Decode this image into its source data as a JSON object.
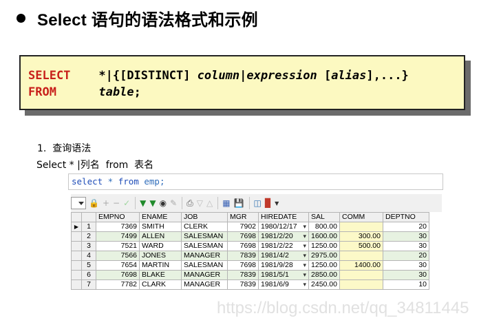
{
  "title": "Select 语句的语法格式和示例",
  "syntax": {
    "line1": {
      "kw": "SELECT",
      "rest_plain": "*|{[DISTINCT] ",
      "rest_italic_1": "column",
      "rest_plain_2": "|",
      "rest_italic_2": "expression",
      "rest_plain_3": " [",
      "rest_italic_3": "alias",
      "rest_plain_4": "],...}"
    },
    "line2": {
      "kw": "FROM",
      "rest_italic": "table",
      "rest_plain": ";"
    }
  },
  "notes": {
    "line1": "1.  查询语法",
    "line2": "Select * |列名  from  表名"
  },
  "sql_editor": {
    "kw1": "select",
    "star": " * ",
    "kw2": "from",
    "rest": " emp;"
  },
  "toolbar": {
    "icons": [
      "dropdown",
      "lock-icon",
      "plus-icon",
      "minus-icon",
      "check-icon",
      "arrow-down-first-icon",
      "arrow-down-last-icon",
      "binoculars-icon",
      "pen-icon",
      "print-icon",
      "down-icon",
      "up-icon",
      "grid-icon",
      "save-icon",
      "db-icon",
      "chart-icon"
    ]
  },
  "grid": {
    "columns": [
      "EMPNO",
      "ENAME",
      "JOB",
      "MGR",
      "HIREDATE",
      "SAL",
      "COMM",
      "DEPTNO"
    ],
    "rows": [
      [
        "1",
        "7369",
        "SMITH",
        "CLERK",
        "7902",
        "1980/12/17",
        "800.00",
        "",
        "20"
      ],
      [
        "2",
        "7499",
        "ALLEN",
        "SALESMAN",
        "7698",
        "1981/2/20",
        "1600.00",
        "300.00",
        "30"
      ],
      [
        "3",
        "7521",
        "WARD",
        "SALESMAN",
        "7698",
        "1981/2/22",
        "1250.00",
        "500.00",
        "30"
      ],
      [
        "4",
        "7566",
        "JONES",
        "MANAGER",
        "7839",
        "1981/4/2",
        "2975.00",
        "",
        "20"
      ],
      [
        "5",
        "7654",
        "MARTIN",
        "SALESMAN",
        "7698",
        "1981/9/28",
        "1250.00",
        "1400.00",
        "30"
      ],
      [
        "6",
        "7698",
        "BLAKE",
        "MANAGER",
        "7839",
        "1981/5/1",
        "2850.00",
        "",
        "30"
      ],
      [
        "7",
        "7782",
        "CLARK",
        "MANAGER",
        "7839",
        "1981/6/9",
        "2450.00",
        "",
        "10"
      ]
    ]
  },
  "watermark": "https://blog.csdn.net/qq_34811445"
}
